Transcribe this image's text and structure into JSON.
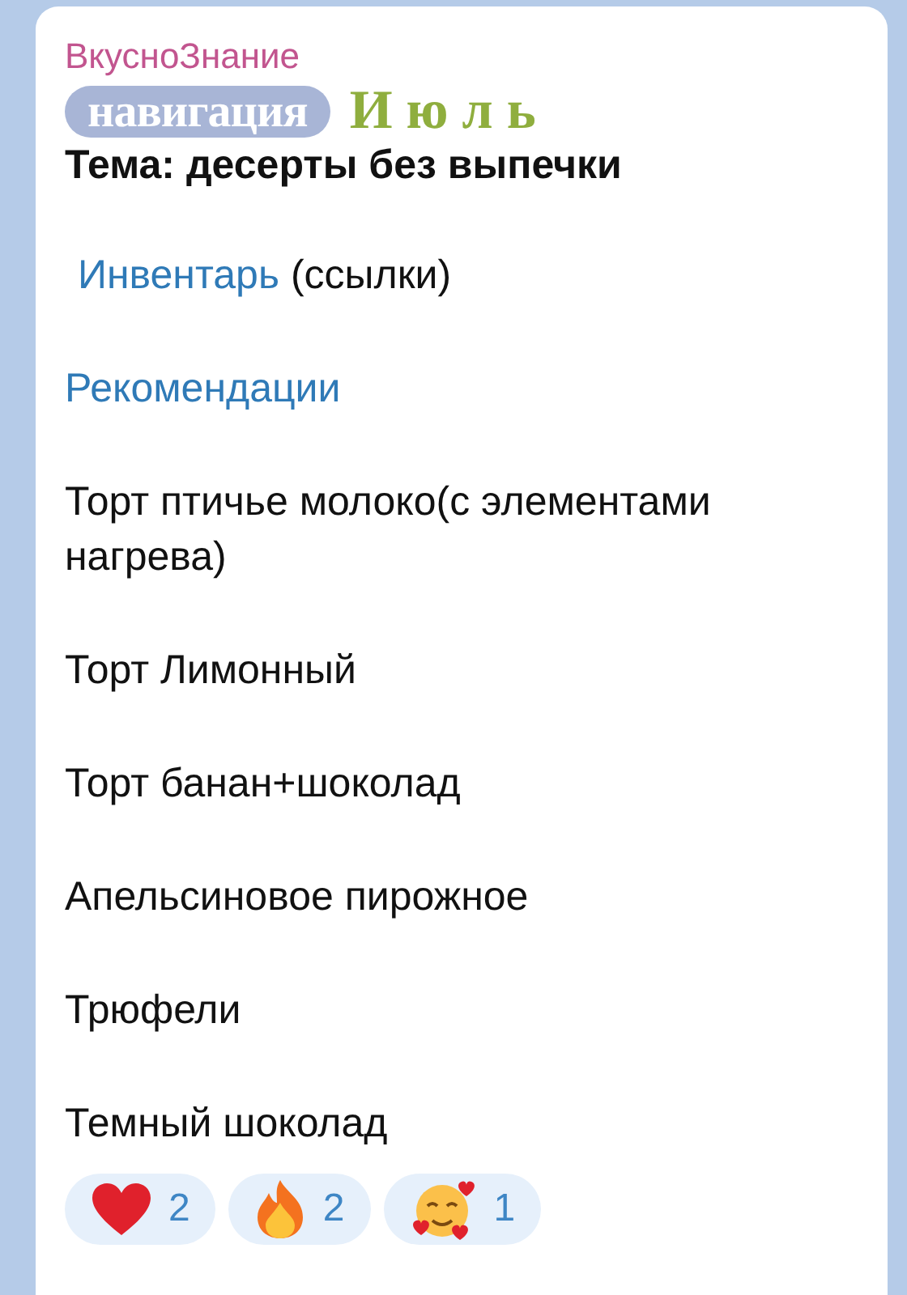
{
  "channel": {
    "name": "ВкусноЗнание"
  },
  "banner": {
    "label": "навигация",
    "month": "И ю л ь"
  },
  "topic": "Тема: десерты без выпечки",
  "links": [
    {
      "text": "Инвентарь",
      "note": "(ссылки)"
    },
    {
      "text": "Рекомендации"
    }
  ],
  "recipes": [
    {
      "text": "Торт птичье молоко(с элементами нагрева)"
    },
    {
      "text": "Торт Лимонный"
    },
    {
      "text": "Торт банан+шоколад"
    },
    {
      "text": "Апельсиновое пирожное"
    },
    {
      "text": "Трюфели"
    },
    {
      "text": "Темный шоколад"
    }
  ],
  "reactions": [
    {
      "kind": "heart",
      "count": "2"
    },
    {
      "kind": "fire",
      "count": "2"
    },
    {
      "kind": "smile-hearts",
      "count": "1"
    }
  ]
}
